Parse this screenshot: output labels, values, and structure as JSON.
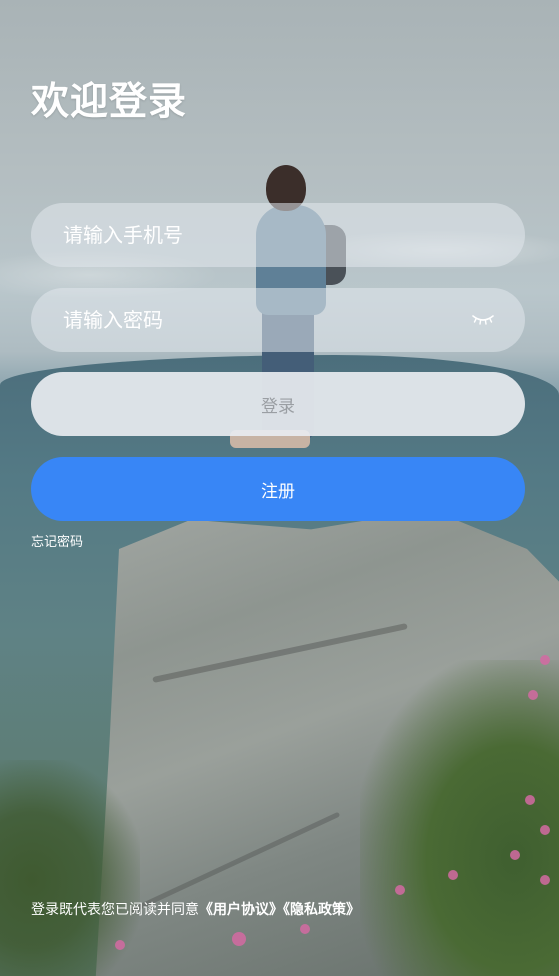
{
  "header": {
    "title": "欢迎登录"
  },
  "form": {
    "phone_placeholder": "请输入手机号",
    "password_placeholder": "请输入密码",
    "password_toggle_icon": "eye-closed-icon",
    "login_label": "登录",
    "register_label": "注册",
    "forgot_label": "忘记密码"
  },
  "agreement": {
    "prefix": "登录既代表您已阅读并同意",
    "user_agreement": "《用户协议》",
    "privacy_policy": "《隐私政策》"
  },
  "colors": {
    "primary": "#3886f6",
    "title_text": "#ffffff",
    "login_button_bg": "#e8ecf0",
    "login_button_text": "#9a9ea3"
  }
}
